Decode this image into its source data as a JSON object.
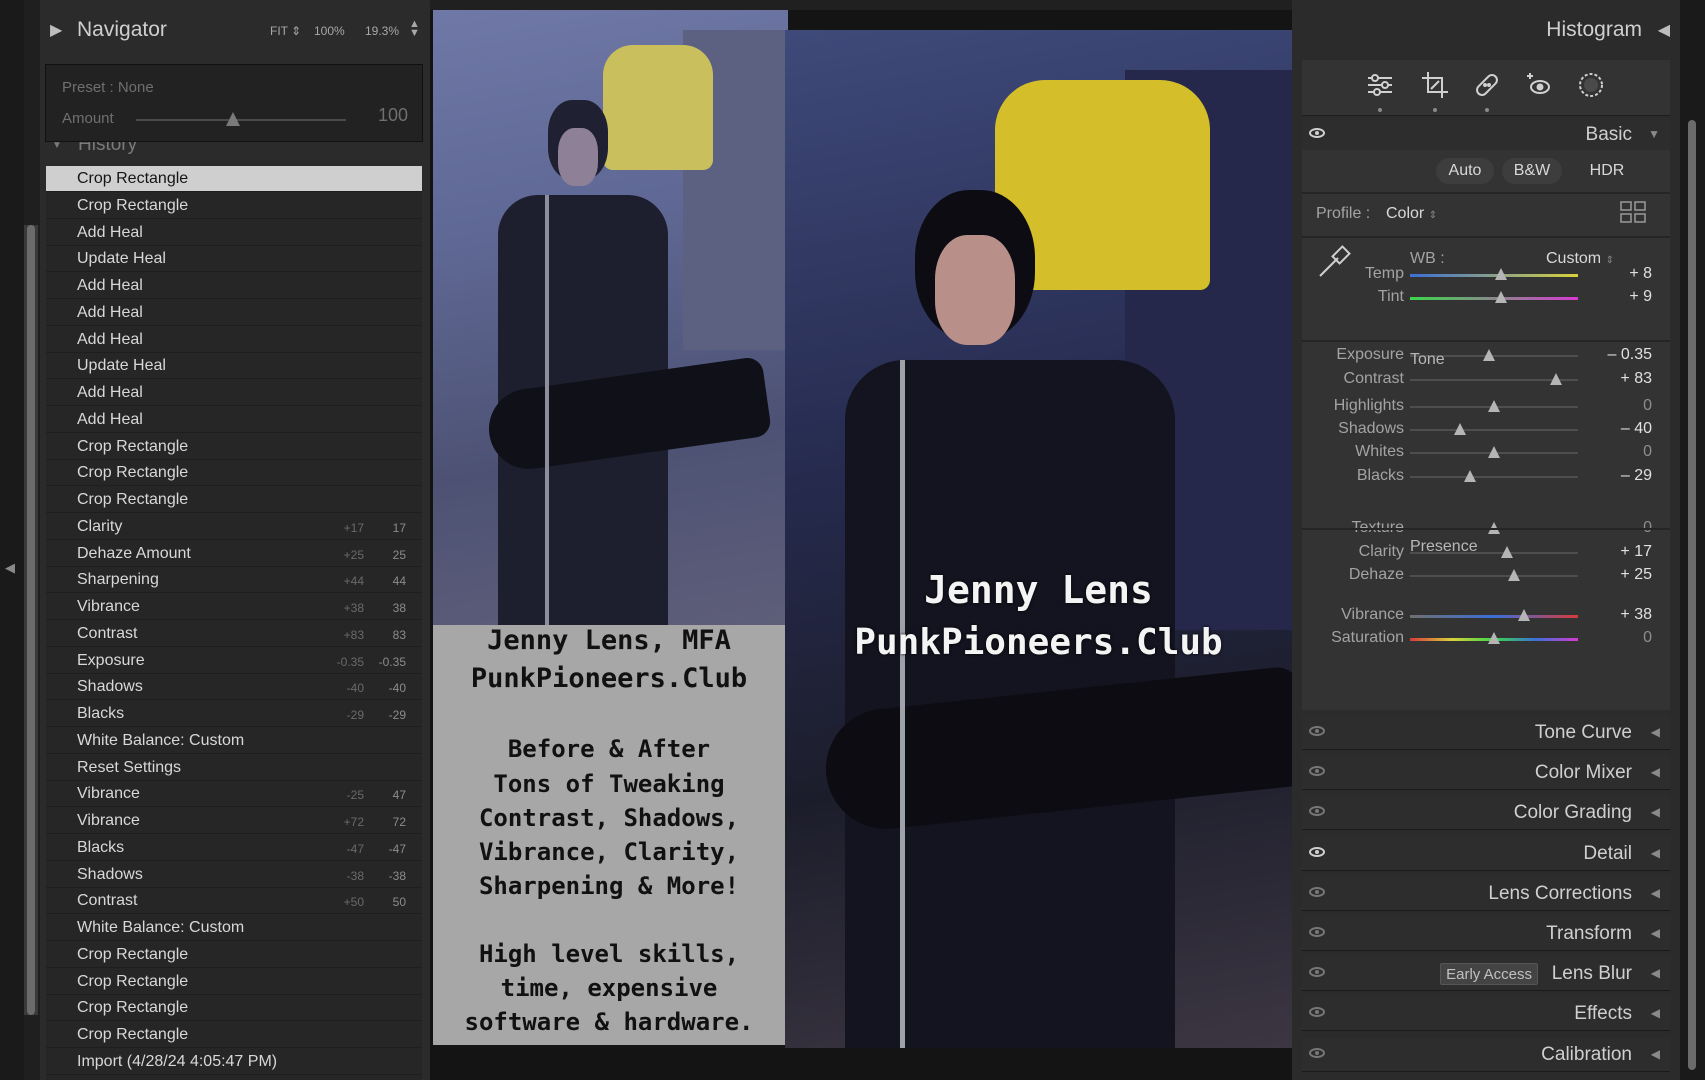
{
  "navigator": {
    "title": "Navigator",
    "zoom_fit": "FIT",
    "zoom_100": "100%",
    "zoom_custom": "19.3%",
    "preset_label": "Preset : None",
    "amount_label": "Amount",
    "amount_value": "100",
    "amount_fraction": 0.46
  },
  "history": {
    "title": "History",
    "items": [
      {
        "label": "Crop Rectangle",
        "delta": "",
        "value": ""
      },
      {
        "label": "Crop Rectangle",
        "delta": "",
        "value": ""
      },
      {
        "label": "Add Heal",
        "delta": "",
        "value": ""
      },
      {
        "label": "Update Heal",
        "delta": "",
        "value": ""
      },
      {
        "label": "Add Heal",
        "delta": "",
        "value": ""
      },
      {
        "label": "Add Heal",
        "delta": "",
        "value": ""
      },
      {
        "label": "Add Heal",
        "delta": "",
        "value": ""
      },
      {
        "label": "Update Heal",
        "delta": "",
        "value": ""
      },
      {
        "label": "Add Heal",
        "delta": "",
        "value": ""
      },
      {
        "label": "Add Heal",
        "delta": "",
        "value": ""
      },
      {
        "label": "Crop Rectangle",
        "delta": "",
        "value": ""
      },
      {
        "label": "Crop Rectangle",
        "delta": "",
        "value": ""
      },
      {
        "label": "Crop Rectangle",
        "delta": "",
        "value": ""
      },
      {
        "label": "Clarity",
        "delta": "+17",
        "value": "17"
      },
      {
        "label": "Dehaze Amount",
        "delta": "+25",
        "value": "25"
      },
      {
        "label": "Sharpening",
        "delta": "+44",
        "value": "44"
      },
      {
        "label": "Vibrance",
        "delta": "+38",
        "value": "38"
      },
      {
        "label": "Contrast",
        "delta": "+83",
        "value": "83"
      },
      {
        "label": "Exposure",
        "delta": "-0.35",
        "value": "-0.35"
      },
      {
        "label": "Shadows",
        "delta": "-40",
        "value": "-40"
      },
      {
        "label": "Blacks",
        "delta": "-29",
        "value": "-29"
      },
      {
        "label": "White Balance: Custom",
        "delta": "",
        "value": ""
      },
      {
        "label": "Reset Settings",
        "delta": "",
        "value": ""
      },
      {
        "label": "Vibrance",
        "delta": "-25",
        "value": "47"
      },
      {
        "label": "Vibrance",
        "delta": "+72",
        "value": "72"
      },
      {
        "label": "Blacks",
        "delta": "-47",
        "value": "-47"
      },
      {
        "label": "Shadows",
        "delta": "-38",
        "value": "-38"
      },
      {
        "label": "Contrast",
        "delta": "+50",
        "value": "50"
      },
      {
        "label": "White Balance: Custom",
        "delta": "",
        "value": ""
      },
      {
        "label": "Crop Rectangle",
        "delta": "",
        "value": ""
      },
      {
        "label": "Crop Rectangle",
        "delta": "",
        "value": ""
      },
      {
        "label": "Crop Rectangle",
        "delta": "",
        "value": ""
      },
      {
        "label": "Crop Rectangle",
        "delta": "",
        "value": ""
      },
      {
        "label": "Import (4/28/24 4:05:47 PM)",
        "delta": "",
        "value": ""
      }
    ],
    "selected_index": 0
  },
  "image": {
    "card_lines": [
      "Jenny Lens, MFA",
      "PunkPioneers.Club",
      "Before & After",
      "Tons of Tweaking",
      "Contrast, Shadows,",
      "Vibrance, Clarity,",
      "Sharpening & More!",
      "High level skills,",
      "time, expensive",
      "software & hardware."
    ],
    "watermark_line1": "Jenny Lens",
    "watermark_line2": "PunkPioneers.Club"
  },
  "histogram": {
    "title": "Histogram"
  },
  "tools": [
    "edit-sliders-icon",
    "crop-icon",
    "healing-icon",
    "red-eye-icon",
    "masking-icon"
  ],
  "basic": {
    "title": "Basic",
    "btn_auto": "Auto",
    "btn_bw": "B&W",
    "btn_hdr": "HDR",
    "profile_label": "Profile :",
    "profile_value": "Color",
    "wb_label": "WB :",
    "wb_value": "Custom",
    "tone_label": "Tone",
    "presence_label": "Presence",
    "sliders": {
      "temp": {
        "label": "Temp",
        "value": "+ 8",
        "pos": 0.54
      },
      "tint": {
        "label": "Tint",
        "value": "+ 9",
        "pos": 0.54
      },
      "exposure": {
        "label": "Exposure",
        "value": "– 0.35",
        "pos": 0.47
      },
      "contrast": {
        "label": "Contrast",
        "value": "+ 83",
        "pos": 0.87
      },
      "highlights": {
        "label": "Highlights",
        "value": "0",
        "pos": 0.5
      },
      "shadows": {
        "label": "Shadows",
        "value": "– 40",
        "pos": 0.3
      },
      "whites": {
        "label": "Whites",
        "value": "0",
        "pos": 0.5
      },
      "blacks": {
        "label": "Blacks",
        "value": "– 29",
        "pos": 0.36
      },
      "texture": {
        "label": "Texture",
        "value": "0",
        "pos": 0.5
      },
      "clarity": {
        "label": "Clarity",
        "value": "+ 17",
        "pos": 0.58
      },
      "dehaze": {
        "label": "Dehaze",
        "value": "+ 25",
        "pos": 0.62
      },
      "vibrance": {
        "label": "Vibrance",
        "value": "+ 38",
        "pos": 0.68
      },
      "saturation": {
        "label": "Saturation",
        "value": "0",
        "pos": 0.5
      }
    }
  },
  "panels": [
    {
      "title": "Tone Curve",
      "visible": false
    },
    {
      "title": "Color Mixer",
      "visible": false
    },
    {
      "title": "Color Grading",
      "visible": false
    },
    {
      "title": "Detail",
      "visible": true
    },
    {
      "title": "Lens Corrections",
      "visible": false
    },
    {
      "title": "Transform",
      "visible": false
    },
    {
      "title": "Lens Blur",
      "visible": false,
      "badge": "Early Access"
    },
    {
      "title": "Effects",
      "visible": false
    },
    {
      "title": "Calibration",
      "visible": false
    }
  ],
  "colors": {
    "panel_bg": "#2b2b2b",
    "selected_row": "#cfcfcf",
    "text": "#cfcfcf"
  }
}
